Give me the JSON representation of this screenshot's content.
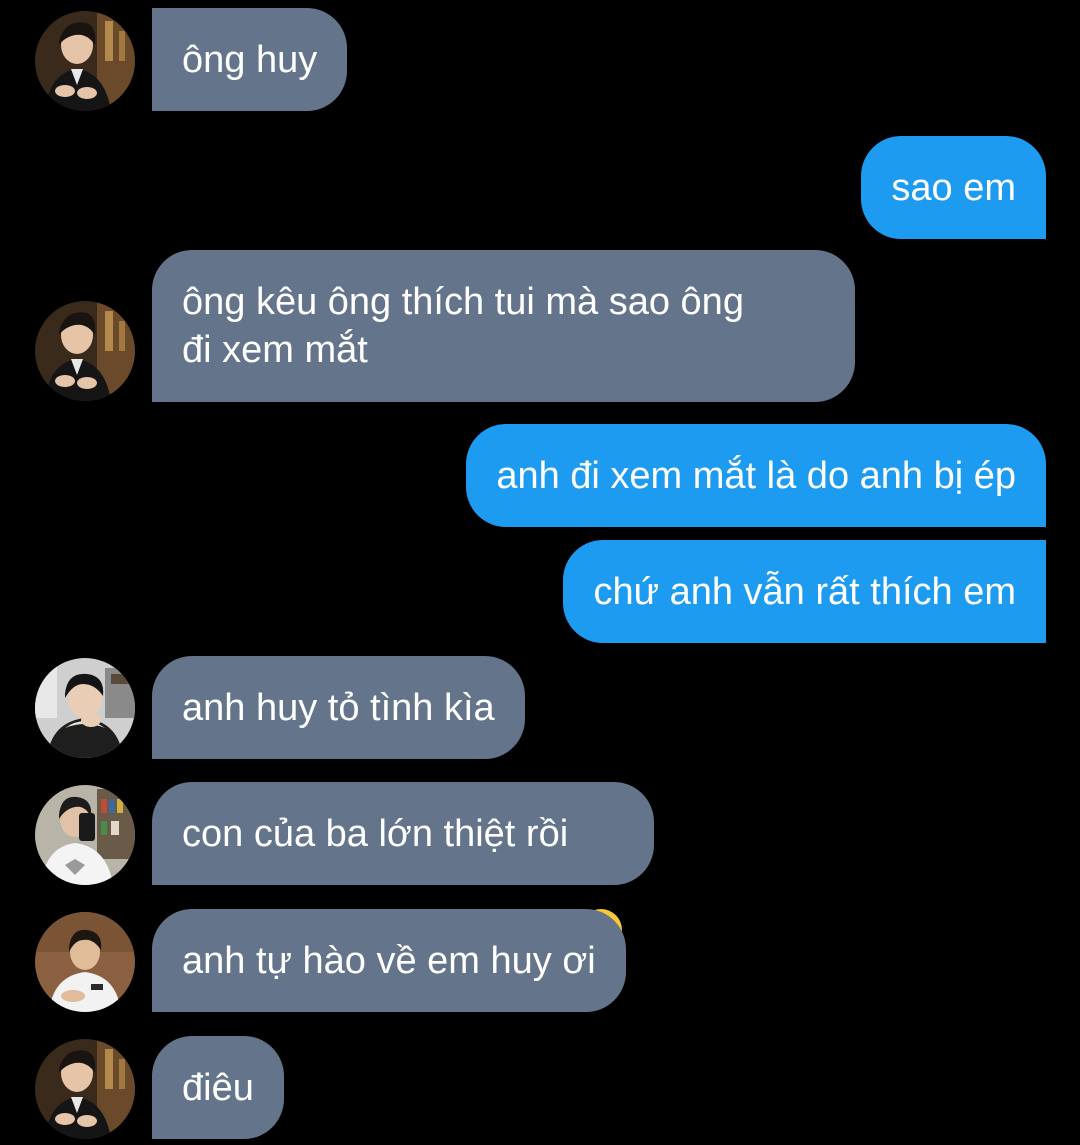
{
  "chat": {
    "messages": [
      {
        "id": "m1",
        "direction": "incoming",
        "sender_avatar": "avatar-huy",
        "text": "ông huy"
      },
      {
        "id": "m2",
        "direction": "outgoing",
        "text": "sao em"
      },
      {
        "id": "m3",
        "direction": "incoming",
        "sender_avatar": "avatar-huy",
        "text": "ông kêu ông thích tui mà sao ông\nđi xem mắt"
      },
      {
        "id": "m4",
        "direction": "outgoing",
        "text": "anh đi xem mắt là do anh bị ép"
      },
      {
        "id": "m5",
        "direction": "outgoing",
        "text": "chứ anh vẫn rất thích em"
      },
      {
        "id": "m6",
        "direction": "incoming",
        "sender_avatar": "avatar-hoodie",
        "text": "anh huy tỏ tình kìa"
      },
      {
        "id": "m7",
        "direction": "incoming",
        "sender_avatar": "avatar-mirror-selfie",
        "text": "con của ba lớn thiệt rồi",
        "emoji": "sneezing-face-icon"
      },
      {
        "id": "m8",
        "direction": "incoming",
        "sender_avatar": "avatar-white-shirt",
        "text": "anh tự hào về em huy ơi"
      },
      {
        "id": "m9",
        "direction": "incoming",
        "sender_avatar": "avatar-huy",
        "text": "điêu"
      }
    ]
  },
  "colors": {
    "background": "#000000",
    "incoming_bubble": "#64748a",
    "outgoing_bubble": "#1d9bf0",
    "text": "#ffffff"
  }
}
